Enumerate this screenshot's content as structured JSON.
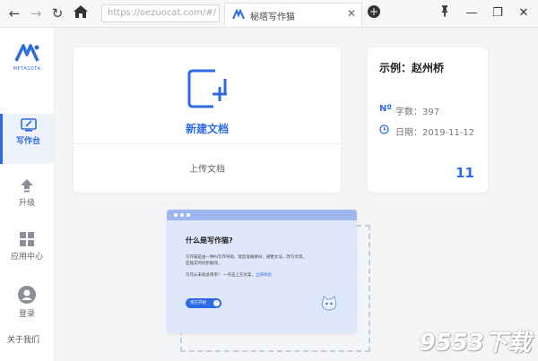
{
  "browser": {
    "address": "https://oezuocat.com/#/",
    "tab_title": "秘塔写作猫",
    "tab_close": "✕",
    "new_tab": "+",
    "win_pin": "📌",
    "win_min": "—",
    "win_restore": "❐",
    "win_close": "✕"
  },
  "sidebar": {
    "logo_text": "METASOTA",
    "items": [
      {
        "label": "写作台",
        "icon": "edit-screen-icon",
        "active": true
      },
      {
        "label": "升级",
        "icon": "upload-arrow-icon"
      },
      {
        "label": "应用中心",
        "icon": "grid-apps-icon"
      },
      {
        "label": "登录",
        "icon": "user-icon"
      }
    ],
    "about": "关于我们"
  },
  "newdoc": {
    "title": "新建文档",
    "upload": "上传文档"
  },
  "example": {
    "title": "示例：赵州桥",
    "words_label": "字数：",
    "words": "397",
    "date_label": "日期：",
    "date": "2019-11-12",
    "count": "11"
  },
  "promo": {
    "title": "什么是写作猫?",
    "line1": "写作猫是由一种AI写作导助，帮您准确拼纠，规整文法，改写文风，",
    "line2": "还能实时同步翻译。",
    "line3_prefix": "写作从未如此简单！ 一点击上方文案，",
    "line3_link": "立即体验",
    "button": "现在开始"
  },
  "watermark": "9553下载",
  "colors": {
    "accent": "#2d6be4",
    "promo_bg": "#dfe8fb",
    "promo_bar": "#9db6ee"
  }
}
